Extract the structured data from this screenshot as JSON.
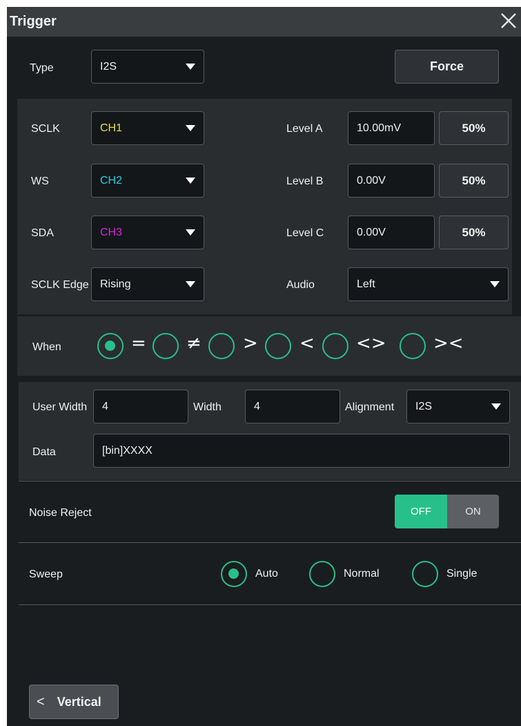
{
  "dialog": {
    "title": "Trigger"
  },
  "type_row": {
    "label": "Type",
    "value": "I2S",
    "force_label": "Force"
  },
  "sources": [
    {
      "label": "SCLK",
      "value": "CH1",
      "value_color": "#e8e03a",
      "level_label": "Level A",
      "level_value": "10.00mV",
      "pct_label": "50%"
    },
    {
      "label": "WS",
      "value": "CH2",
      "value_color": "#2ed1e0",
      "level_label": "Level B",
      "level_value": "0.00V",
      "pct_label": "50%"
    },
    {
      "label": "SDA",
      "value": "CH3",
      "value_color": "#d42ad8",
      "level_label": "Level C",
      "level_value": "0.00V",
      "pct_label": "50%"
    }
  ],
  "edge_row": {
    "label": "SCLK Edge",
    "value": "Rising",
    "audio_label": "Audio",
    "audio_value": "Left"
  },
  "when": {
    "label": "When",
    "options": [
      "=",
      "≠",
      ">",
      "<",
      "<>",
      "><"
    ],
    "selected_index": 0
  },
  "widths": {
    "user_width_label": "User Width",
    "user_width_value": "4",
    "width_label": "Width",
    "width_value": "4",
    "alignment_label": "Alignment",
    "alignment_value": "I2S"
  },
  "data_row": {
    "label": "Data",
    "value": "[bin]XXXX"
  },
  "noise_reject": {
    "label": "Noise Reject",
    "off_label": "OFF",
    "on_label": "ON",
    "state": "OFF"
  },
  "sweep": {
    "label": "Sweep",
    "options": [
      "Auto",
      "Normal",
      "Single"
    ],
    "selected": "Auto"
  },
  "nav": {
    "back_label": "Vertical"
  },
  "colors": {
    "accent": "#27c08a",
    "panel_bg": "#1a1d1f",
    "section_bg": "#2a2d30"
  }
}
